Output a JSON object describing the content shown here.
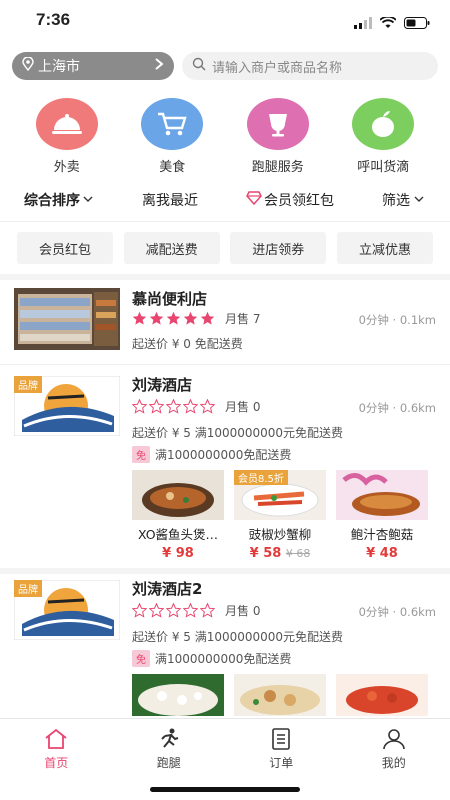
{
  "status": {
    "time": "7:36"
  },
  "location": {
    "city": "上海市"
  },
  "search": {
    "placeholder": "请输入商户或商品名称"
  },
  "categories": [
    {
      "label": "外卖",
      "icon": "dish-cover-icon",
      "color": "#f07a7a"
    },
    {
      "label": "美食",
      "icon": "cart-icon",
      "color": "#6aa5e8"
    },
    {
      "label": "跑腿服务",
      "icon": "cup-icon",
      "color": "#de6fb0"
    },
    {
      "label": "呼叫货滴",
      "icon": "apple-icon",
      "color": "#7ccf5f"
    }
  ],
  "sortbar": {
    "comprehensive": "综合排序",
    "nearest": "离我最近",
    "member": "会员领红包",
    "filter": "筛选"
  },
  "filters": [
    "会员红包",
    "减配送费",
    "进店领券",
    "立减优惠"
  ],
  "shops": [
    {
      "name": "慕尚便利店",
      "rating": 5,
      "monthly": "月售 7",
      "dist": "0分钟 · 0.1km",
      "min": "起送价 ¥ 0  免配送费"
    },
    {
      "name": "刘涛酒店",
      "rating": 0,
      "monthly": "月售 0",
      "dist": "0分钟 · 0.6km",
      "min": "起送价 ¥ 5  满1000000000元免配送费",
      "brand": "品牌",
      "promo_badge": "免",
      "promo": "满1000000000免配送费",
      "dishes": [
        {
          "name": "XO酱鱼头煲…",
          "price": "¥ 98",
          "old": ""
        },
        {
          "name": "豉椒炒蟹柳",
          "price": "¥ 58",
          "old": "¥ 68",
          "tag": "会员8.5折"
        },
        {
          "name": "鲍汁杏鲍菇",
          "price": "¥ 48",
          "old": ""
        }
      ]
    },
    {
      "name": "刘涛酒店2",
      "rating": 0,
      "monthly": "月售 0",
      "dist": "0分钟 · 0.6km",
      "min": "起送价 ¥ 5  满1000000000元免配送费",
      "brand": "品牌",
      "promo_badge": "免",
      "promo": "满1000000000免配送费"
    }
  ],
  "tabs": [
    {
      "label": "首页",
      "icon": "home-icon",
      "active": true
    },
    {
      "label": "跑腿",
      "icon": "runner-icon"
    },
    {
      "label": "订单",
      "icon": "order-icon"
    },
    {
      "label": "我的",
      "icon": "user-icon"
    }
  ],
  "colors": {
    "accent": "#e8456f",
    "star": "#e8456f",
    "price": "#e23b3b"
  }
}
